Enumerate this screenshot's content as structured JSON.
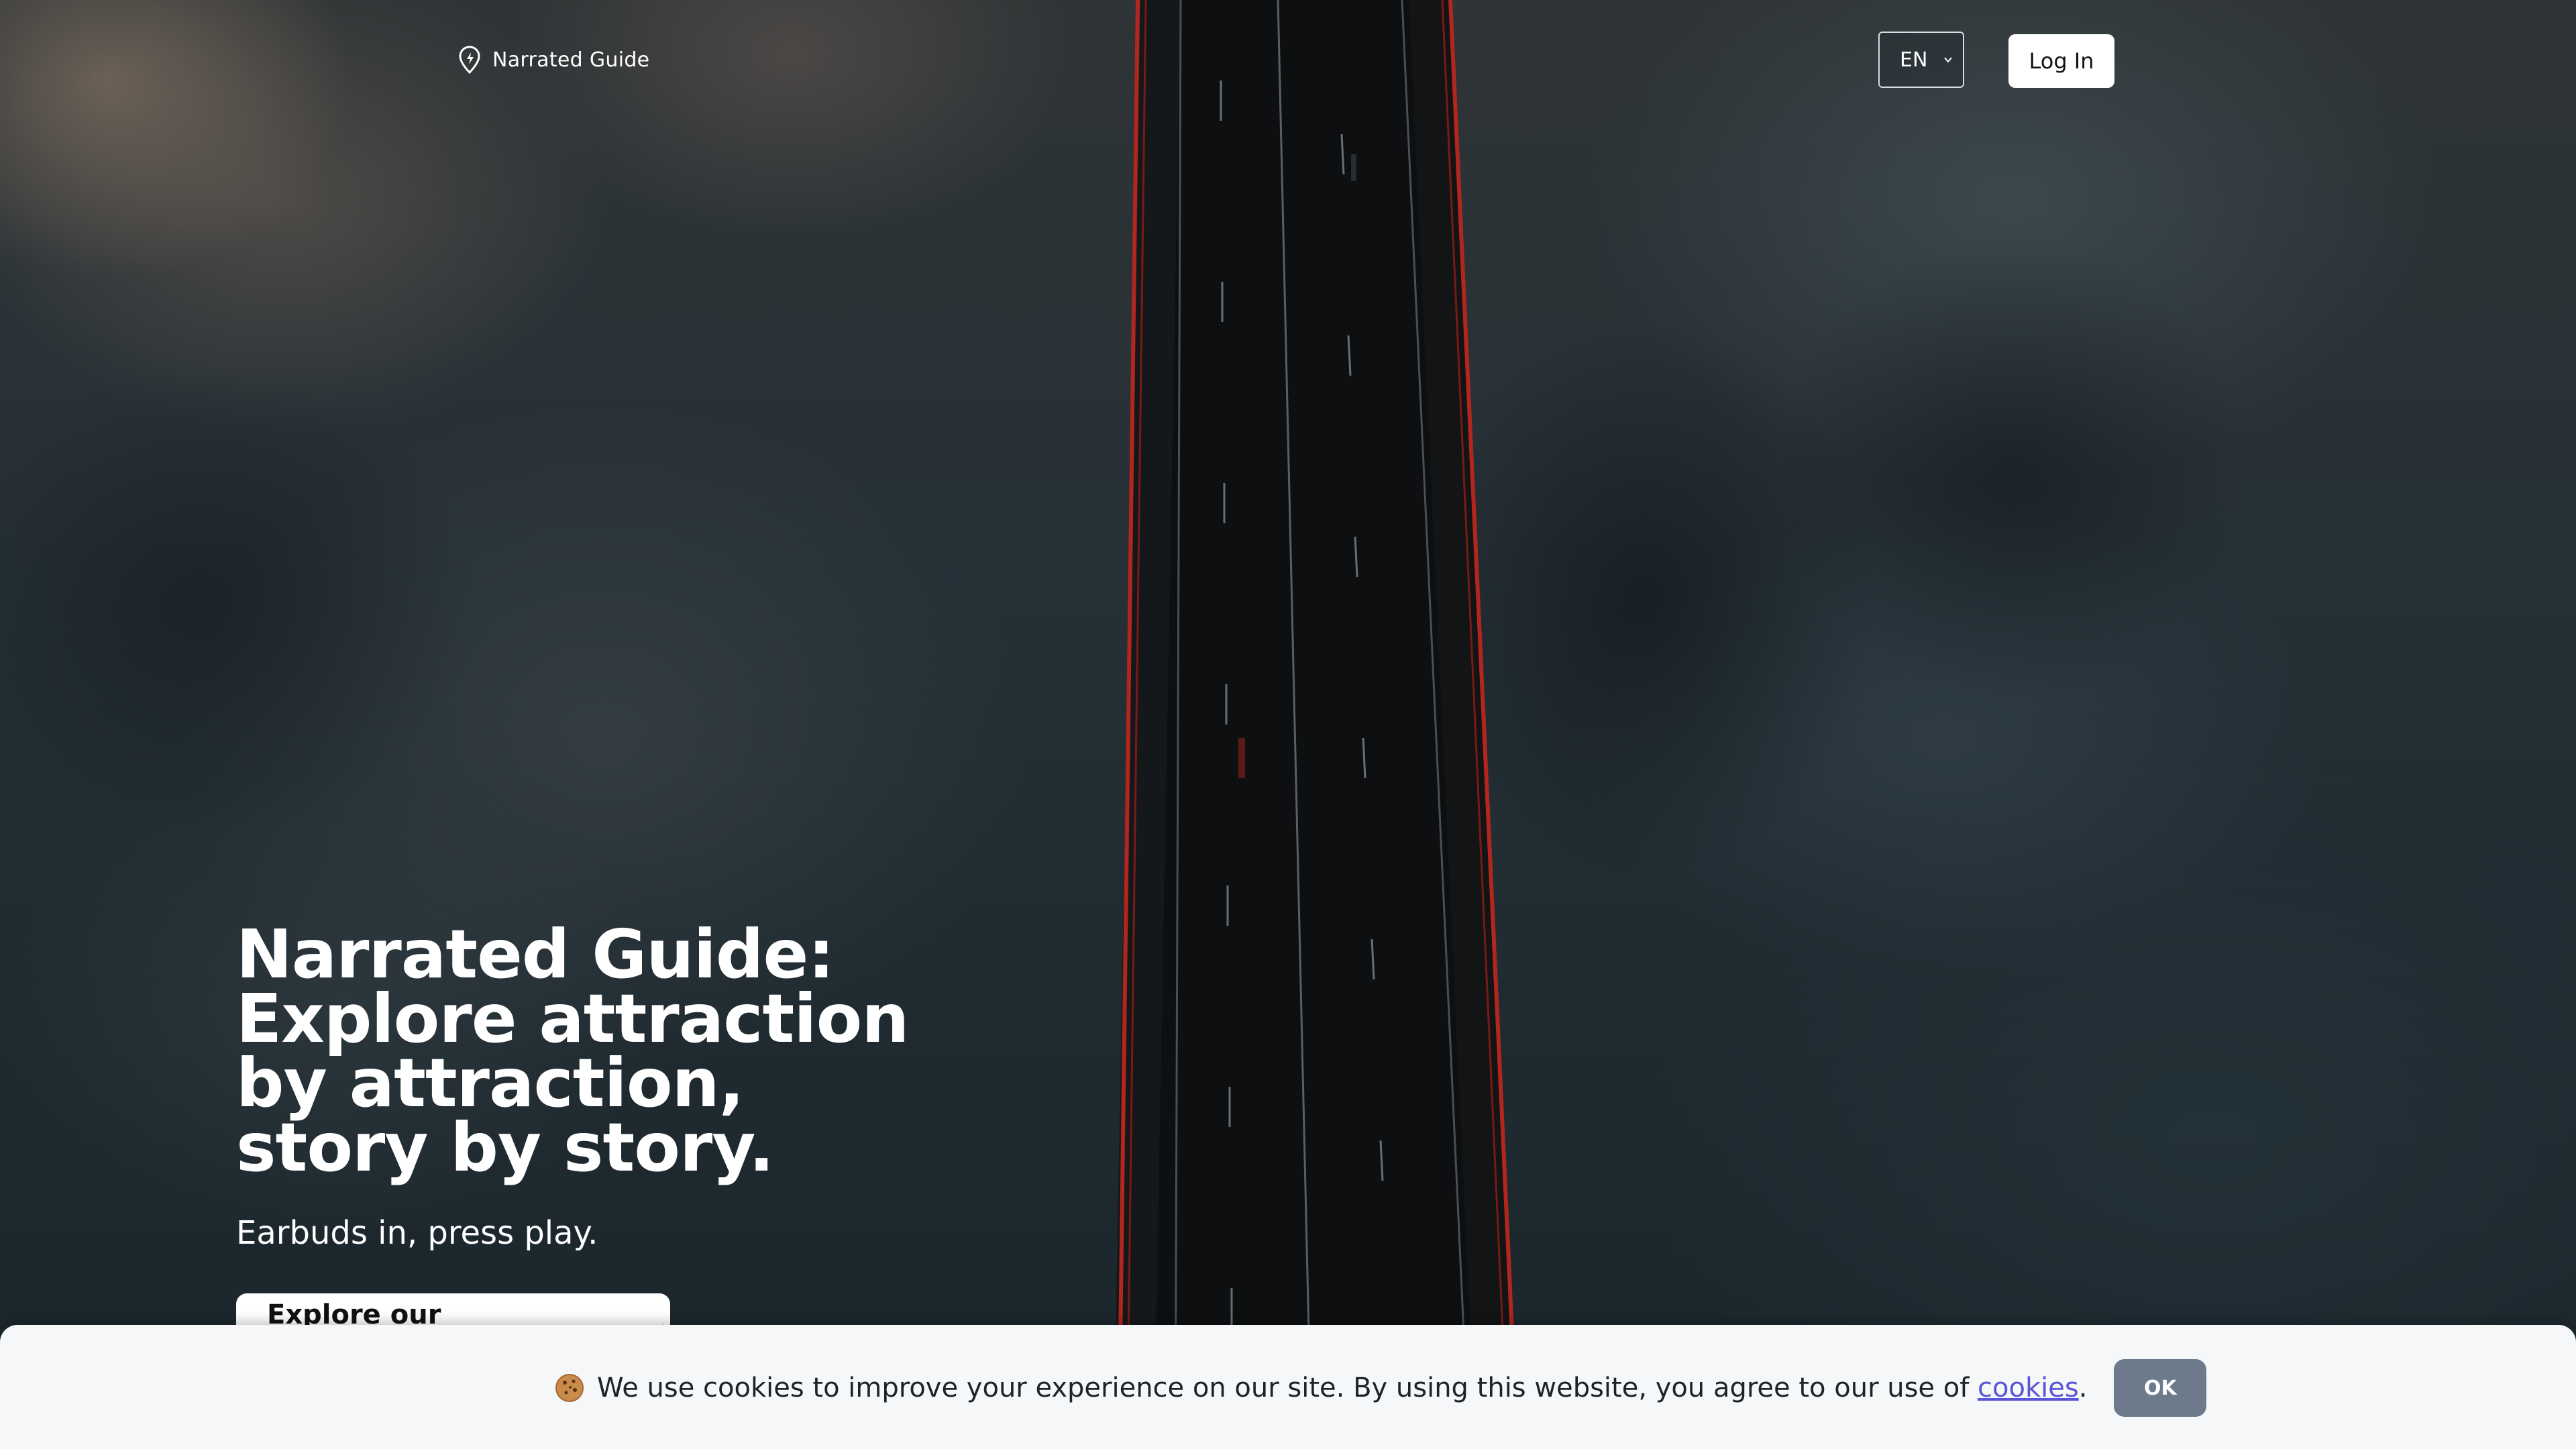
{
  "header": {
    "brand_name": "Narrated Guide",
    "language": "EN",
    "login_label": "Log In"
  },
  "hero": {
    "title": "Narrated Guide: Explore attraction by attraction, story by story.",
    "subtitle": "Earbuds in, press play.",
    "cta_label": "Explore our destinations",
    "cta_arrow": "→"
  },
  "cookie_banner": {
    "emoji": "cookie-icon",
    "text": "We use cookies to improve your experience on our site. By using this website, you agree to our use of ",
    "link_label": "cookies",
    "trailing": ".",
    "ok_label": "OK"
  },
  "colors": {
    "cookie_link": "#5a55d6",
    "ok_button": "#6d7a8b",
    "bridge_cable": "#b3261e"
  }
}
